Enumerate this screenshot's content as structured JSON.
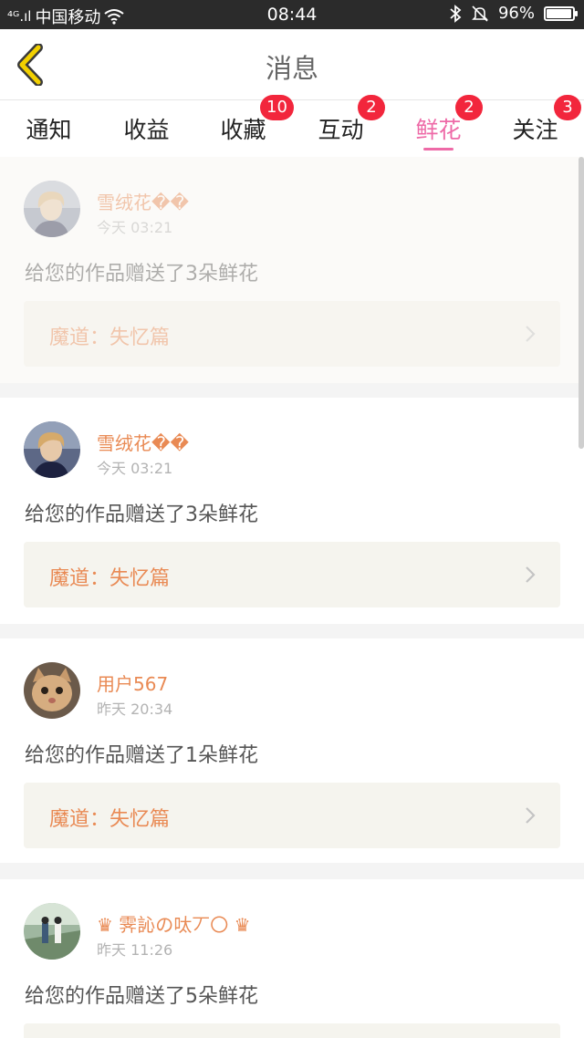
{
  "status_bar": {
    "signal": "⁴ᴳ.ıl",
    "carrier": "中国移动",
    "time": "08:44",
    "battery": "96%",
    "battery_level": 0.96
  },
  "nav": {
    "title": "消息"
  },
  "tabs": [
    {
      "label": "通知",
      "badge": null,
      "active": false
    },
    {
      "label": "收益",
      "badge": null,
      "active": false
    },
    {
      "label": "收藏",
      "badge": "10",
      "active": false
    },
    {
      "label": "互动",
      "badge": "2",
      "active": false
    },
    {
      "label": "鲜花",
      "badge": "2",
      "active": true
    },
    {
      "label": "关注",
      "badge": "3",
      "active": false
    }
  ],
  "messages": [
    {
      "name": "雪绒花��",
      "time": "今天 03:21",
      "text": "给您的作品赠送了3朵鲜花",
      "work": "魔道：失忆篇",
      "avatar": "girl-avatar"
    },
    {
      "name": "雪绒花��",
      "time": "今天 03:21",
      "text": "给您的作品赠送了3朵鲜花",
      "work": "魔道：失忆篇",
      "avatar": "girl-avatar"
    },
    {
      "name": "用户567",
      "time": "昨天 20:34",
      "text": "给您的作品赠送了1朵鲜花",
      "work": "魔道：失忆篇",
      "avatar": "cat-avatar"
    },
    {
      "name": "♛ 霁訫の呔丆〇 ♛",
      "time": "昨天 11:26",
      "text": "给您的作品赠送了5朵鲜花",
      "work": "",
      "avatar": "couple-avatar"
    }
  ],
  "colors": {
    "accent": "#ee6aa7",
    "name": "#e98a54",
    "badge": "#f2263c",
    "back_arrow": "#f2d000"
  }
}
